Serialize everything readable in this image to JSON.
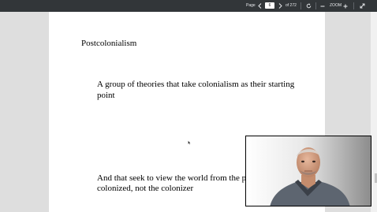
{
  "toolbar": {
    "page_label": "Page",
    "page_current": "6",
    "page_total": "of 272",
    "zoom_label": "ZOOM",
    "icons": [
      "chevron-left-icon",
      "chevron-right-icon",
      "rotate-icon",
      "minus-icon",
      "plus-icon",
      "expand-icon"
    ]
  },
  "document": {
    "heading": "Postcolonialism",
    "point1_line1": "A group of theories that take colonialism as their starting",
    "point1_line2": "point",
    "point2_line1": "And that seek to view the world from the pers",
    "point2_line2": "colonized, not the colonizer"
  },
  "colors": {
    "toolbar_bg": "#323639",
    "viewer_bg": "#dedede",
    "page_bg": "#ffffff"
  }
}
